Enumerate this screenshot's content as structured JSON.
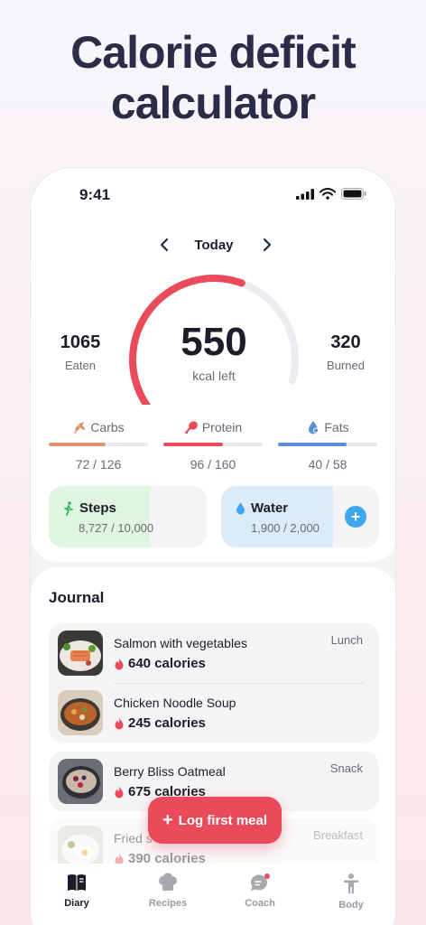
{
  "headline": {
    "line1": "Calorie deficit",
    "line2": "calculator"
  },
  "status": {
    "time": "9:41",
    "icons": [
      "signal-icon",
      "wifi-icon",
      "battery-icon"
    ]
  },
  "date_nav": {
    "label": "Today"
  },
  "summary": {
    "kcal_left": "550",
    "kcal_left_label": "kcal left",
    "eaten_value": "1065",
    "eaten_label": "Eaten",
    "burned_value": "320",
    "burned_label": "Burned",
    "progress_fraction": 0.66
  },
  "macros": [
    {
      "label": "Carbs",
      "value": "72 / 126",
      "fraction": 0.57,
      "color": "#e0936a",
      "icon": "wheat-icon"
    },
    {
      "label": "Protein",
      "value": "96 / 160",
      "fraction": 0.6,
      "color": "#ea4b5a",
      "icon": "drumstick-icon"
    },
    {
      "label": "Fats",
      "value": "40 / 58",
      "fraction": 0.69,
      "color": "#5b8fd6",
      "icon": "oil-icon"
    }
  ],
  "tiles": {
    "steps": {
      "title": "Steps",
      "value": "8,727 / 10,000",
      "fraction": 0.87,
      "color": "#dff5df",
      "accent": "#2fb25a"
    },
    "water": {
      "title": "Water",
      "value": "1,900 / 2,000",
      "fraction": 0.95,
      "color": "#dcebf8",
      "accent": "#3da7f0",
      "add": "+"
    }
  },
  "journal": {
    "title": "Journal",
    "groups": [
      {
        "tag": "Lunch",
        "items": [
          {
            "name": "Salmon with vegetables",
            "calories": "640 calories"
          },
          {
            "name": "Chicken Noodle Soup",
            "calories": "245 calories"
          }
        ]
      },
      {
        "tag": "Snack",
        "items": [
          {
            "name": "Berry Bliss Oatmeal",
            "calories": "675 calories"
          }
        ]
      },
      {
        "tag": "Breakfast",
        "items": [
          {
            "name": "Fried s",
            "calories": "390 calories"
          }
        ]
      }
    ]
  },
  "cta": {
    "icon": "+",
    "label": "Log first meal"
  },
  "tabs": [
    {
      "label": "Diary",
      "icon": "book-icon",
      "active": true
    },
    {
      "label": "Recipes",
      "icon": "chef-hat-icon",
      "active": false
    },
    {
      "label": "Coach",
      "icon": "chat-icon",
      "active": false
    },
    {
      "label": "Body",
      "icon": "body-icon",
      "active": false
    }
  ],
  "colors": {
    "accent": "#ea4b5a",
    "headline": "#2a2c48",
    "track": "#ececf0"
  }
}
